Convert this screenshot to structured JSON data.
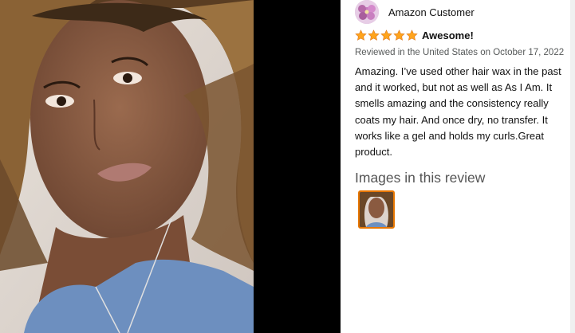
{
  "review": {
    "reviewer_name": "Amazon Customer",
    "rating": 5,
    "title": "Awesome!",
    "meta": "Reviewed in the United States on October 17, 2022",
    "body": "Amazing. I’ve used other hair wax in the past and it worked, but not as well as As I Am. It smells amazing and the consistency really coats my hair. And once dry, no transfer. It works like a gel and holds my curls.Great product.",
    "images_heading": "Images in this review"
  },
  "colors": {
    "star": "#ffa41c",
    "thumb_border": "#e77600",
    "meta_text": "#565959"
  }
}
